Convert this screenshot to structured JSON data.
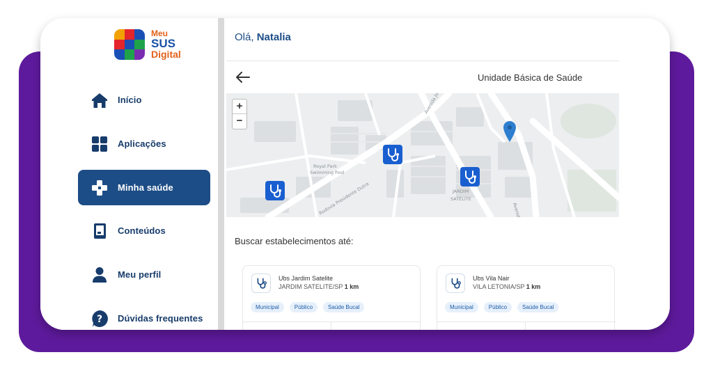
{
  "logo": {
    "line1": "Meu",
    "line2": "SUS",
    "line3": "Digital"
  },
  "sidebar": {
    "items": [
      {
        "label": "Início",
        "icon": "home-icon"
      },
      {
        "label": "Aplicações",
        "icon": "grid-icon"
      },
      {
        "label": "Minha saúde",
        "icon": "health-cross-icon",
        "active": true
      },
      {
        "label": "Conteúdos",
        "icon": "book-icon"
      },
      {
        "label": "Meu perfil",
        "icon": "user-icon"
      },
      {
        "label": "Dúvidas frequentes",
        "icon": "question-icon"
      }
    ]
  },
  "header": {
    "greeting_prefix": "Olá,",
    "user_name": "Natalia"
  },
  "page": {
    "title": "Unidade Básica de Saúde",
    "search_label": "Buscar estabelecimentos até:"
  },
  "map": {
    "zoom_in": "+",
    "zoom_out": "−",
    "labels": [
      "Royal Park",
      "Swimming Pool",
      "JARDIM",
      "SATÉLITE",
      "Rodovia Presidente Dutra",
      "Avenida Jorge Zarur",
      "Avenida"
    ]
  },
  "establishments": [
    {
      "name": "Ubs Jardim Satelite",
      "location": "JARDIM SATELITE/SP",
      "distance": "1 km",
      "tags": [
        "Municipal",
        "Público",
        "Saúde Bucal"
      ]
    },
    {
      "name": "Ubs Vila Nair",
      "location": "VILA LETONIA/SP",
      "distance": "1 km",
      "tags": [
        "Municipal",
        "Público",
        "Saúde Bucal"
      ]
    }
  ],
  "colors": {
    "brand_blue": "#1d4d86",
    "purple": "#5e1a9c",
    "marker_blue": "#1a5fd0",
    "pin_blue": "#2e7fcf"
  }
}
